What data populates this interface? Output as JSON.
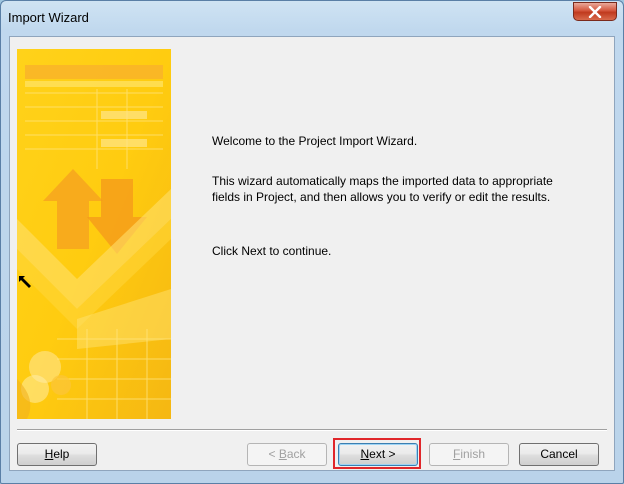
{
  "window": {
    "title": "Import Wizard"
  },
  "content": {
    "welcome": "Welcome to the Project Import Wizard.",
    "description": "This wizard automatically maps the imported data to appropriate fields in Project, and then allows you to verify or edit the results.",
    "instruction": "Click Next to continue."
  },
  "buttons": {
    "help": {
      "mnemonic": "H",
      "rest": "elp"
    },
    "back": {
      "prefix": "< ",
      "mnemonic": "B",
      "rest": "ack"
    },
    "next": {
      "mnemonic": "N",
      "rest": "ext >"
    },
    "finish": {
      "mnemonic": "F",
      "rest": "inish"
    },
    "cancel": "Cancel"
  },
  "colors": {
    "banner_yellow": "#ffd21a",
    "banner_orange": "#f7b01e",
    "highlight_red": "#e0262a",
    "title_bar": "#c0d8ee"
  },
  "icons": [
    "close-icon",
    "mouse-pointer-icon",
    "wizard-banner-arrows"
  ]
}
